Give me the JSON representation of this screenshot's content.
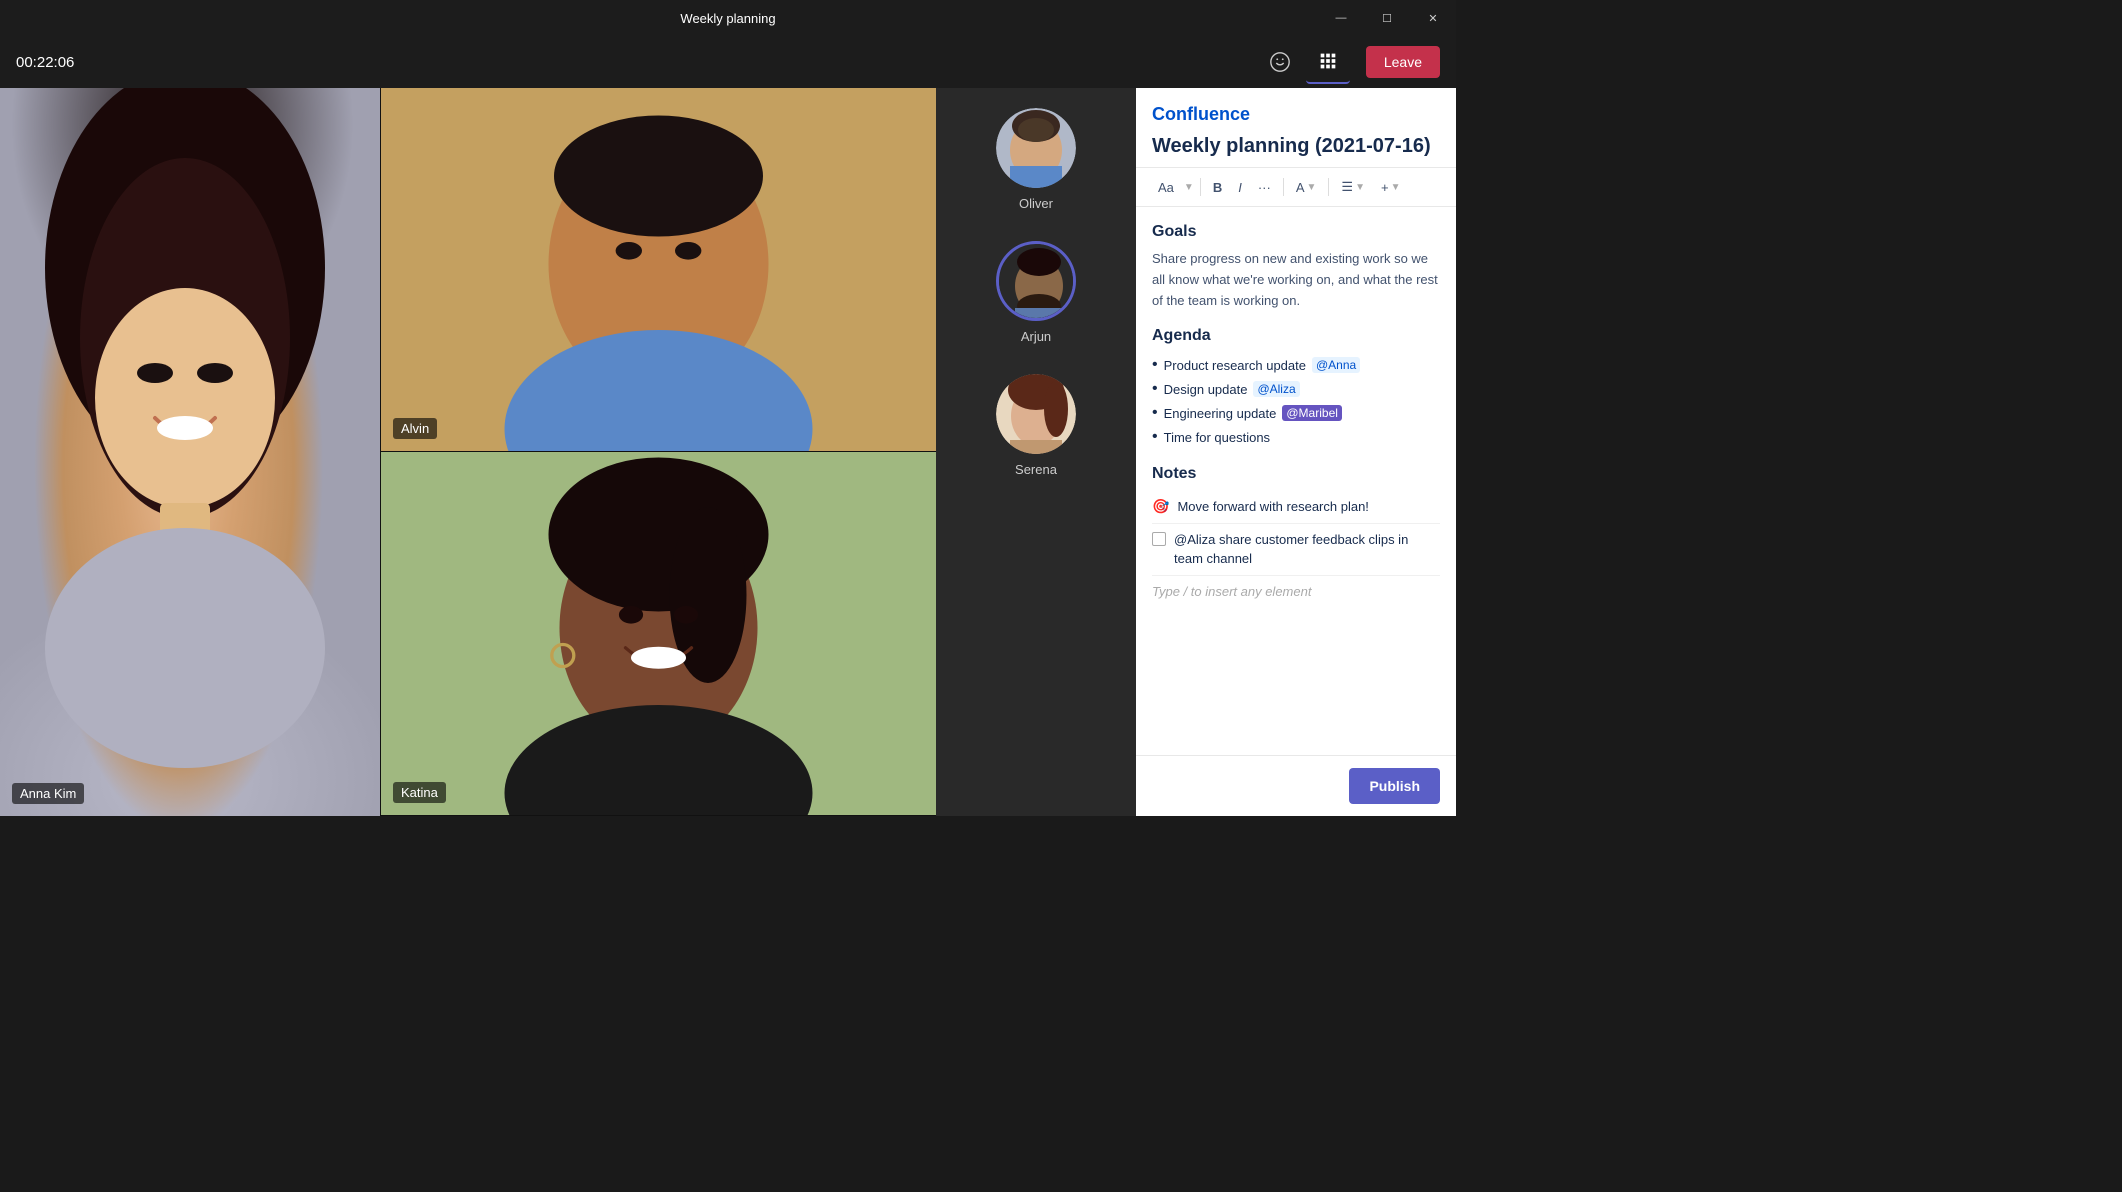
{
  "window": {
    "title": "Weekly planning",
    "controls": {
      "minimize": "—",
      "maximize": "☐",
      "close": "✕"
    }
  },
  "topbar": {
    "timer": "00:22:06",
    "leave_label": "Leave"
  },
  "participants": [
    {
      "name": "Oliver",
      "avatar_class": "oliver-photo",
      "active": false
    },
    {
      "name": "Arjun",
      "avatar_class": "arjun-photo",
      "active": true
    },
    {
      "name": "Serena",
      "avatar_class": "serena-photo",
      "active": false
    }
  ],
  "video_feeds": [
    {
      "name": "Anna Kim",
      "position": "left-large",
      "face_class": "anna-photo"
    },
    {
      "name": "Alvin",
      "position": "top-right",
      "face_class": "alvin-photo"
    },
    {
      "name": "Katina",
      "position": "bottom-right",
      "face_class": "katina-photo"
    }
  ],
  "confluence": {
    "logo": "Confluence",
    "doc_title": "Weekly planning (2021-07-16)",
    "toolbar": {
      "font_size": "Aa",
      "bold": "B",
      "italic": "I",
      "more": "···",
      "color": "A",
      "list": "☰",
      "add": "+"
    },
    "goals": {
      "heading": "Goals",
      "text": "Share progress on new and existing work so we all know what we're working on, and what the rest of the team is working on."
    },
    "agenda": {
      "heading": "Agenda",
      "items": [
        {
          "text": "Product research update ",
          "mention": "@Anna",
          "mention_style": "blue"
        },
        {
          "text": "Design update ",
          "mention": "@Aliza",
          "mention_style": "blue"
        },
        {
          "text": "Engineering update ",
          "mention": "@Maribel",
          "mention_style": "purple"
        },
        {
          "text": "Time for questions",
          "mention": "",
          "mention_style": ""
        }
      ]
    },
    "notes": {
      "heading": "Notes",
      "items": [
        {
          "type": "icon",
          "text": "Move forward with research plan!"
        },
        {
          "type": "checkbox",
          "text": "@Aliza  share customer feedback clips in team channel"
        }
      ]
    },
    "type_hint": "Type / to insert any element",
    "publish_label": "Publish"
  }
}
